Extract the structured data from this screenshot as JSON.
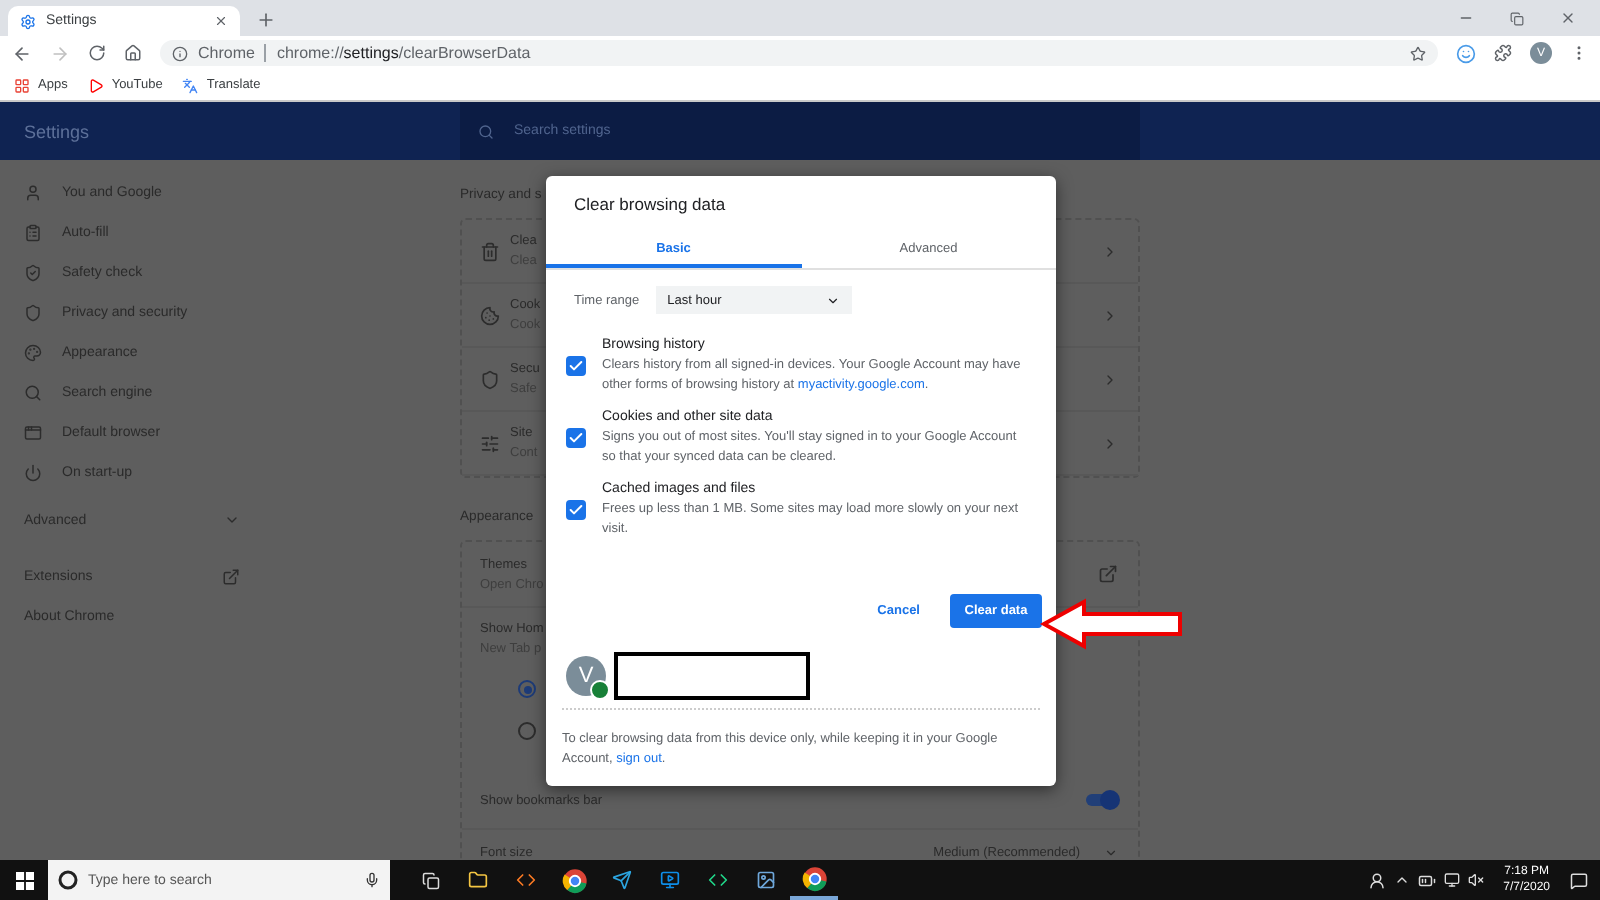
{
  "browser": {
    "tabs": [
      {
        "title": "Settings",
        "selected": true
      }
    ],
    "address": {
      "site_label": "Chrome",
      "url": "chrome://**settings**/clearBrowserData"
    },
    "profile_initial": "V",
    "bookmarks": [
      {
        "label": "Apps",
        "kind": "apps"
      },
      {
        "label": "YouTube",
        "kind": "video"
      },
      {
        "label": "Translate",
        "kind": "translate"
      }
    ]
  },
  "settings": {
    "title": "Settings",
    "search": {
      "placeholder": "Search settings"
    },
    "sidebar": {
      "items": [
        {
          "label": "You and Google",
          "kind": "person"
        },
        {
          "label": "Auto-fill",
          "kind": "clipboard"
        },
        {
          "label": "Safety check",
          "kind": "shield"
        },
        {
          "label": "Privacy and security",
          "kind": "shield-half"
        },
        {
          "label": "Appearance",
          "kind": "palette"
        },
        {
          "label": "Search engine",
          "kind": "search"
        },
        {
          "label": "Default browser",
          "kind": "window"
        },
        {
          "label": "On start-up",
          "kind": "power"
        }
      ],
      "advanced": {
        "label": "Advanced",
        "expanded": false
      },
      "links": [
        {
          "label": "Extensions",
          "external": true
        },
        {
          "label": "About Chrome",
          "external": false
        }
      ]
    },
    "sections": [
      {
        "heading": "Privacy and s",
        "rows": [
          {
            "kind": "arrow",
            "title": "Clea",
            "subtitle": "Clea"
          },
          {
            "kind": "arrow",
            "title": "Cook",
            "subtitle": "Cook"
          },
          {
            "kind": "arrow",
            "title": "Secu",
            "subtitle": "Safe"
          },
          {
            "kind": "arrow",
            "title": "Site",
            "subtitle": "Cont"
          }
        ]
      },
      {
        "heading": "Appearance",
        "rows": [
          {
            "kind": "external",
            "title": "Themes",
            "subtitle": "Open Chro"
          },
          {
            "kind": "radios",
            "title": "Show Hom",
            "subtitle": "New Tab p",
            "options": [
              {
                "selected": true
              },
              {
                "selected": false
              }
            ]
          },
          {
            "kind": "toggle",
            "title": "Show bookmarks bar",
            "on": true
          },
          {
            "kind": "select",
            "title": "Font size",
            "value": "Medium (Recommended)"
          }
        ]
      }
    ]
  },
  "dialog": {
    "title": "Clear browsing data",
    "tabs": [
      {
        "label": "Basic",
        "selected": true
      },
      {
        "label": "Advanced",
        "selected": false
      }
    ],
    "time_range": {
      "label": "Time range",
      "value": "Last hour"
    },
    "options": [
      {
        "title": "Browsing history",
        "description": "Clears history from all signed-in devices. Your Google Account may have other forms of browsing history at ",
        "link": "myactivity.google.com",
        "after": ".",
        "checked": true
      },
      {
        "title": "Cookies and other site data",
        "description": "Signs you out of most sites. You'll stay signed in to your Google Account so that your synced data can be cleared.",
        "checked": true
      },
      {
        "title": "Cached images and files",
        "description": "Frees up less than 1 MB. Some sites may load more slowly on your next visit.",
        "checked": true
      }
    ],
    "cancel": "Cancel",
    "confirm": "Clear data",
    "account": {
      "initial": "V"
    },
    "footer": {
      "text": "To clear browsing data from this device only, while keeping it in your Google Account, ",
      "link": "sign out",
      "after": "."
    }
  },
  "taskbar": {
    "search_placeholder": "Type here to search",
    "time": "7:18 PM",
    "date": "7/7/2020"
  }
}
